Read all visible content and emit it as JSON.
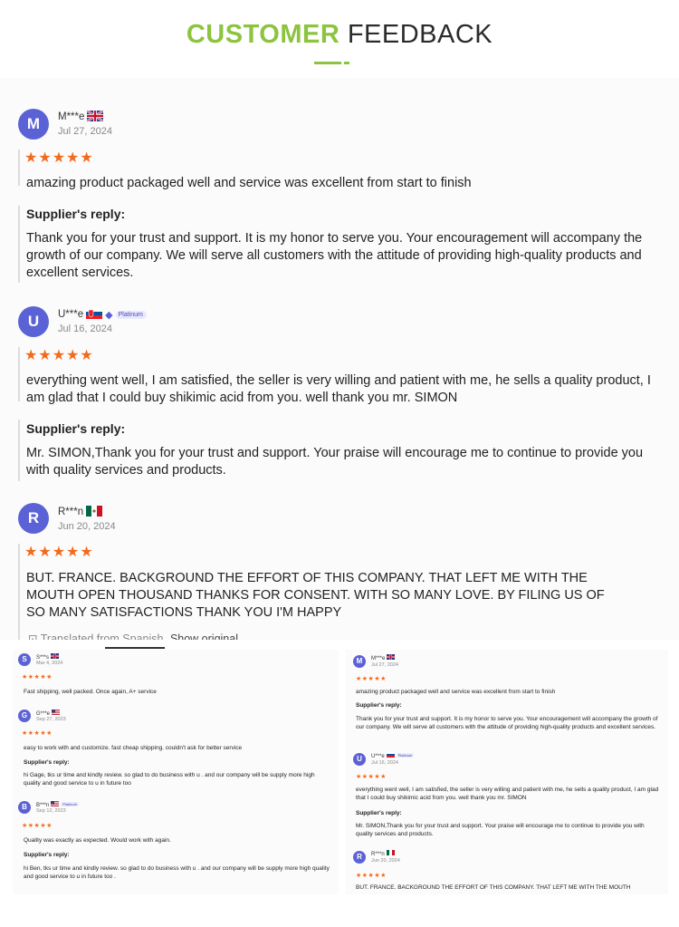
{
  "header": {
    "title_accent": "CUSTOMER",
    "title_rest": "FEEDBACK"
  },
  "main": {
    "reviews": [
      {
        "initial": "M",
        "name": "M***e",
        "flag": "uk-flag-icon",
        "date": "Jul 27, 2024",
        "rating": 5,
        "comment": "amazing product packaged well and service was excellent from start to finish",
        "reply_heading": "Supplier's reply:",
        "reply": "Thank you for your trust and support. It is my honor to serve you. Your encouragement will accompany the growth of our company. We will serve all customers with the attitude of providing high-quality products and excellent services."
      },
      {
        "initial": "U",
        "name": "U***e",
        "flag": "slovakia-flag-icon",
        "badge": "Platinum",
        "date": "Jul 16, 2024",
        "rating": 5,
        "comment": "everything went well, I am satisfied, the seller is very willing and patient with me, he sells a quality product, I am glad that I could buy shikimic acid from you. well thank you mr. SIMON",
        "reply_heading": "Supplier's reply:",
        "reply": "Mr. SIMON,Thank you for your trust and support. Your praise will encourage me to continue to provide you with quality services and products."
      },
      {
        "initial": "R",
        "name": "R***n",
        "flag": "mexico-flag-icon",
        "date": "Jun 20, 2024",
        "rating": 5,
        "comment": "BUT. FRANCE. BACKGROUND THE EFFORT OF THIS COMPANY. THAT LEFT ME WITH THE MOUTH OPEN THOUSAND THANKS FOR CONSENT. WITH SO MANY LOVE. BY FILING US OF SO MANY SATISFACTIONS THANK YOU I'M HAPPY",
        "translated": "Translated from Spanish",
        "show_original": "Show original"
      }
    ],
    "stars": "★★★★★"
  },
  "thumb_left": {
    "reviews": [
      {
        "initial": "S",
        "name": "S***s",
        "date": "Mar 4, 2024",
        "comment": "Fast shipping, well packed. Once again, A+ service"
      },
      {
        "initial": "G",
        "name": "G***e",
        "date": "Sep 27, 2023",
        "comment": "easy to work with and customize. fast cheap shipping. couldn't ask for better service",
        "reply_heading": "Supplier's reply:",
        "reply": "hi Gage, tks ur time and kindly review. so glad to do business with u . and our company will be supply more high quality and good service to u in future too"
      },
      {
        "initial": "B",
        "name": "B***n",
        "badge": "Platinum",
        "date": "Sep 12, 2023",
        "comment": "Quality was exactly as expected. Would work with again.",
        "reply_heading": "Supplier's reply:",
        "reply": "hi Ben, tks ur time and kindly review. so glad to do business with u . and our company will be supply more high quality and good service to u in future too ."
      }
    ]
  },
  "thumb_right": {
    "reviews": [
      {
        "initial": "M",
        "name": "M***e",
        "date": "Jul 27, 2024",
        "comment": "amazing product packaged well and service was excellent from start to finish",
        "reply_heading": "Supplier's reply:",
        "reply": "Thank you for your trust and support. It is my honor to serve you. Your encouragement will accompany the growth of our company. We will serve all customers with the attitude of providing high-quality products and excellent services."
      },
      {
        "initial": "U",
        "name": "U***e",
        "badge": "Platinum",
        "date": "Jul 16, 2024",
        "comment": "everything went well, I am satisfied, the seller is very willing and patient with me, he sells a quality product, I am glad that I could buy shikimic acid from you. well thank you mr. SIMON",
        "reply_heading": "Supplier's reply:",
        "reply": "Mr. SIMON,Thank you for your trust and support. Your praise will encourage me to continue to provide you with quality services and products."
      },
      {
        "initial": "R",
        "name": "R***n",
        "date": "Jun 20, 2024",
        "comment": "BUT. FRANCE. BACKGROUND THE EFFORT OF THIS COMPANY. THAT LEFT ME WITH THE MOUTH"
      }
    ]
  }
}
